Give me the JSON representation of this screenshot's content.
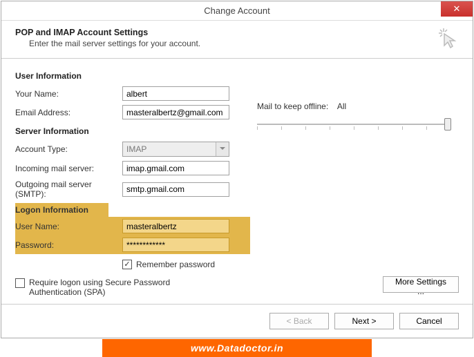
{
  "window": {
    "title": "Change Account",
    "close": "✕"
  },
  "header": {
    "title": "POP and IMAP Account Settings",
    "subtitle": "Enter the mail server settings for your account."
  },
  "sections": {
    "user": "User Information",
    "server": "Server Information",
    "logon": "Logon Information"
  },
  "labels": {
    "name": "Your Name:",
    "email": "Email Address:",
    "acct_type": "Account Type:",
    "incoming": "Incoming mail server:",
    "outgoing": "Outgoing mail server (SMTP):",
    "username": "User Name:",
    "password": "Password:",
    "remember": "Remember password",
    "spa": "Require logon using Secure Password Authentication (SPA)",
    "offline": "Mail to keep offline:"
  },
  "values": {
    "name": "albert",
    "email": "masteralbertz@gmail.com",
    "acct_type": "IMAP",
    "incoming": "imap.gmail.com",
    "outgoing": "smtp.gmail.com",
    "username": "masteralbertz",
    "password": "************",
    "remember_checked": "✓",
    "offline": "All"
  },
  "buttons": {
    "more": "More Settings ...",
    "back": "< Back",
    "next": "Next >",
    "cancel": "Cancel"
  },
  "branding": "www.Datadoctor.in"
}
